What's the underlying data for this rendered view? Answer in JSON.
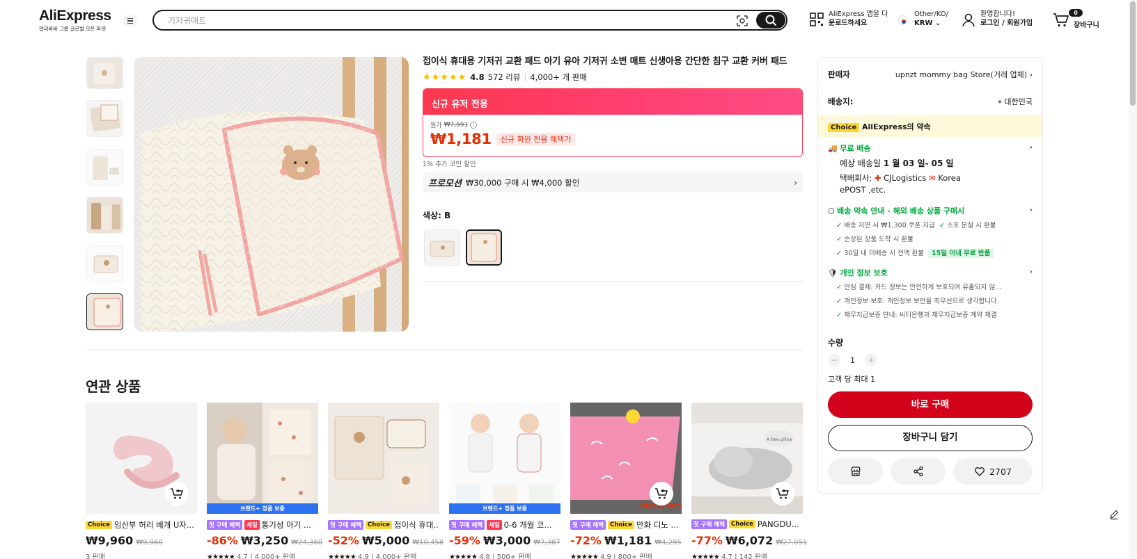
{
  "header": {
    "logo": "AliExpress",
    "logo_sub": "알리바바 그룹 글로벌 오픈 마켓",
    "search_placeholder": "기저귀매트",
    "app_line1": "AliExpress 앱을 다",
    "app_line2": "운로드하세요",
    "lang_line1": "Other/KO/",
    "lang_line2": "KRW",
    "login_line1": "환영합니다!",
    "login_line2": "로그인 / 회원가입",
    "cart_count": "0",
    "cart_label": "장바구니"
  },
  "product": {
    "title": "접이식 휴대용 기저귀 교환 패드 아기 유아 기저귀 소변 매트 신생아용 간단한 침구 교환 커버 패드",
    "stars": "★★★★★",
    "rating": "4.8",
    "reviews": "572 리뷰",
    "sold": "4,000+ 개 판매",
    "promo_header": "신규 유저 전용",
    "orig_label": "원가",
    "orig_price": "₩7,591",
    "price": "₩1,181",
    "new_user_tag": "신규 회원 전용 혜택가",
    "coin_text": "1% 추가 코인 할인",
    "promo_label": "프로모션",
    "promo_text": "₩30,000 구매 시 ₩4,000 할인",
    "color_label": "색상: B"
  },
  "panel": {
    "seller_label": "판매자",
    "seller_name": "upnzt mommy bag Store(거래 업체)",
    "ship_to_label": "배송지:",
    "ship_to_value": "대한민국",
    "choice_tag": "Choice",
    "choice_promise": "AliExpress의 약속",
    "free_shipping": "무료 배송",
    "eta_label": "예상 배송일",
    "eta_value": "1 월 03 일- 05 일",
    "courier_label": "택배회사:",
    "courier_1": "CJLogistics",
    "courier_2": "Korea",
    "courier_3": "ePOST ,etc.",
    "guarantee_title": "배송 약속 안내 - 해외 배송 상품 구매시",
    "g1": "배송 지연 시 ₩1,300 쿠폰 지급",
    "g2": "소포 분실 시 환불",
    "g3": "손상된 상품 도착 시 환불",
    "g4": "30일 내 미배송 시 전액 환불",
    "g4_tag": "15일 이내 무료 반품",
    "privacy_title": "개인 정보 보호",
    "p1": "안심 결제: 카드 정보는 안전하게 보호되며 유출되지 않...",
    "p2": "개인정보 보호: 개인정보 보안을 최우선으로 생각합니다.",
    "p3": "채무지급보증 안내: 씨티은행과 채무지급보증 계약 체결",
    "qty_label": "수량",
    "qty_value": "1",
    "limit": "고객 당 최대 1",
    "buy_now": "바로 구매",
    "add_to_cart": "장바구니 담기",
    "wish_count": "2707"
  },
  "related": {
    "title": "연관 상품",
    "items": [
      {
        "tags": [
          "Choice"
        ],
        "title": "임산부 허리 베개 U자...",
        "discount": "",
        "price": "₩9,960",
        "strike": "₩9,960",
        "rating_stars": "",
        "sold": "3 판매",
        "brand": ""
      },
      {
        "tags": [
          "첫 구매 혜택",
          "세일"
        ],
        "title": "통기성 아기 ...",
        "discount": "-86%",
        "price": "₩3,250",
        "strike": "₩24,360",
        "rating_stars": "★★★★★",
        "sold": "4.7 | 4,000+ 판매",
        "brand": "브랜드+ 정품 보증"
      },
      {
        "tags": [
          "첫 구매 혜택",
          "Choice"
        ],
        "title": "접이식 휴대...",
        "discount": "-52%",
        "price": "₩5,000",
        "strike": "₩10,458",
        "rating_stars": "★★★★★",
        "sold": "4.9 | 4,000+ 판매",
        "brand": ""
      },
      {
        "tags": [
          "첫 구매 혜택",
          "세일"
        ],
        "title": "0-6 개월 코...",
        "discount": "-59%",
        "price": "₩3,000",
        "strike": "₩7,387",
        "rating_stars": "★★★★★",
        "sold": "4.8 | 500+ 판매",
        "brand": "브랜드+ 정품 보증"
      },
      {
        "tags": [
          "첫 구매 혜택",
          "Choice"
        ],
        "title": "만화 디노 ...",
        "discount": "-72%",
        "price": "₩1,181",
        "strike": "₩4,295",
        "rating_stars": "★★★★★",
        "sold": "4.9 | 800+ 판매",
        "brand": ""
      },
      {
        "tags": [
          "첫 구매 혜택",
          "Choice"
        ],
        "title": "PANGDU...",
        "discount": "-77%",
        "price": "₩6,072",
        "strike": "₩27,051",
        "rating_stars": "★★★★★",
        "sold": "4.7 | 142 판매",
        "brand": ""
      }
    ],
    "img_overlay_5": "80x120cm",
    "img_overlay_6": "A free pillow"
  },
  "colors": {
    "accent_red": "#e62e04",
    "buy_red": "#d3031c",
    "promo_pink": "#fd384f",
    "choice_yellow": "#fdd835",
    "green": "#00a73b"
  }
}
